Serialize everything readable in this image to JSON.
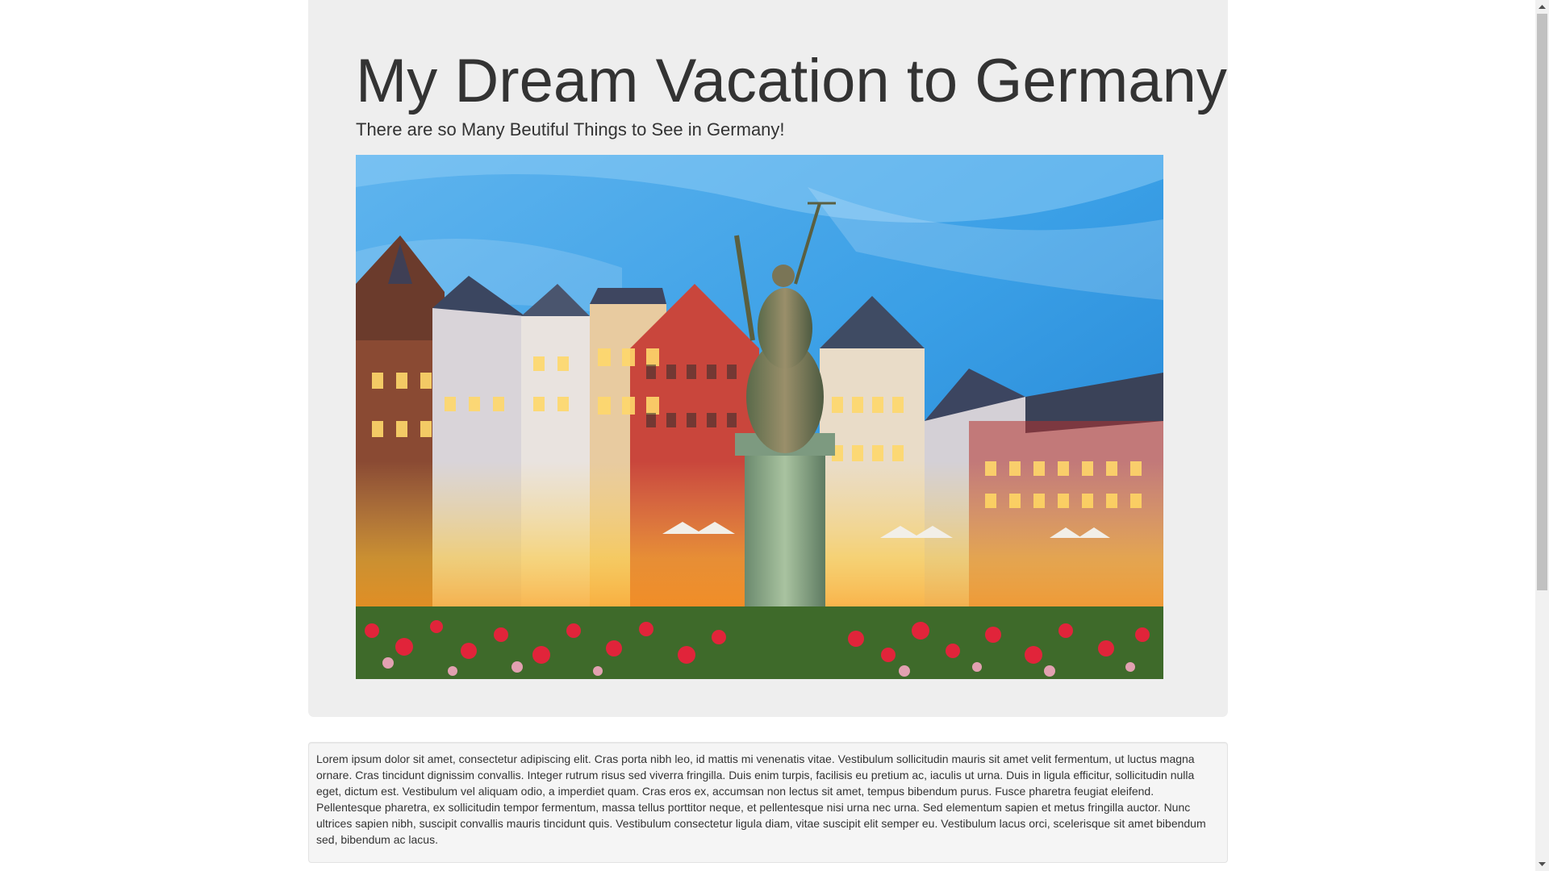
{
  "header": {
    "title": "My Dream Vacation to Germany",
    "subtitle": "There are so Many Beutiful Things to See in Germany!"
  },
  "hero_image": {
    "description_icon": "frankfurt-roemerberg-photo"
  },
  "article": {
    "body": "Lorem ipsum dolor sit amet, consectetur adipiscing elit. Cras porta nibh leo, id mattis mi venenatis vitae. Vestibulum sollicitudin mauris sit amet velit fermentum, ut luctus magna ornare. Cras tincidunt dignissim convallis. Integer rutrum risus sed viverra fringilla. Duis enim turpis, facilisis eu pretium ac, iaculis ut urna. Duis in ligula efficitur, sollicitudin nulla eget, dictum est. Vestibulum vel aliquam odio, a imperdiet quam. Cras eros ex, accumsan non lectus sit amet, tempus bibendum purus. Fusce pharetra feugiat eleifend. Pellentesque pharetra, ex sollicitudin tempor fermentum, massa tellus porttitor neque, et pellentesque nisi urna nec urna. Sed elementum sapien et metus fringilla auctor. Nunc ultrices sapien nibh, suscipit convallis mauris tincidunt quis. Vestibulum consectetur ligula diam, vitae suscipit elit semper eu. Vestibulum lacus orci, scelerisque sit amet bibendum sed, bibendum ac lacus."
  },
  "colors": {
    "jumbotron_bg": "#eeeeee",
    "well_bg": "#f5f5f5",
    "text": "#333333"
  }
}
